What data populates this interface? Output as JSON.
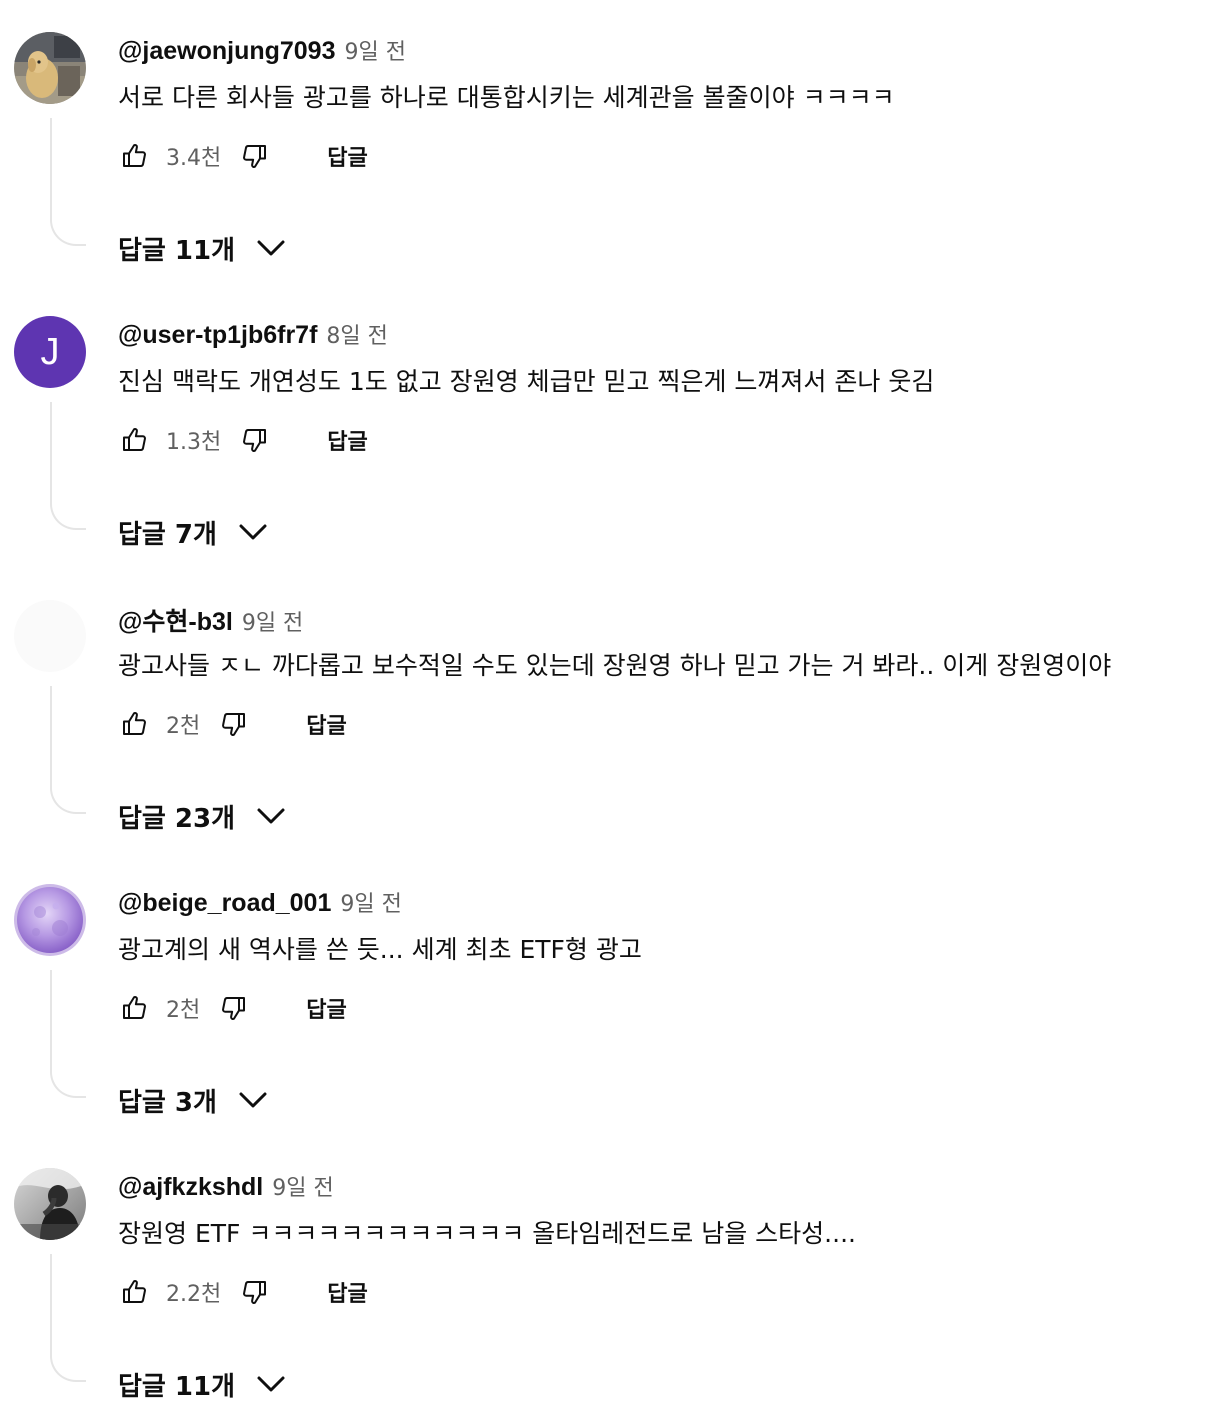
{
  "comments": [
    {
      "author": "@jaewonjung7093",
      "time": "9일 전",
      "text": "서로 다른 회사들 광고를 하나로 대통합시키는 세계관을 볼줄이야 ㅋㅋㅋㅋ",
      "likes": "3.4천",
      "reply_label": "답글",
      "replies_label": "답글 11개",
      "avatar": "photo-dog"
    },
    {
      "author": "@user-tp1jb6fr7f",
      "time": "8일 전",
      "text": "진심 맥락도 개연성도 1도 없고 장원영 체급만 믿고 찍은게 느껴져서 존나 웃김",
      "likes": "1.3천",
      "reply_label": "답글",
      "replies_label": "답글 7개",
      "avatar": "letter",
      "avatar_letter": "J",
      "avatar_color": "#5e35b1"
    },
    {
      "author": "@수현-b3l",
      "time": "9일 전",
      "text": "광고사들 ㅈㄴ 까다롭고 보수적일 수도 있는데 장원영 하나 믿고 가는 거 봐라.. 이게 장원영이야",
      "likes": "2천",
      "reply_label": "답글",
      "replies_label": "답글 23개",
      "avatar": "blank"
    },
    {
      "author": "@beige_road_001",
      "time": "9일 전",
      "text": "광고계의 새 역사를 쓴 듯... 세계 최초 ETF형 광고",
      "likes": "2천",
      "reply_label": "답글",
      "replies_label": "답글 3개",
      "avatar": "photo-purple-moon"
    },
    {
      "author": "@ajfkzkshdl",
      "time": "9일 전",
      "text": "장원영 ETF ㅋㅋㅋㅋㅋㅋㅋㅋㅋㅋㅋㅋ 올타임레전드로 남을 스타성....",
      "likes": "2.2천",
      "reply_label": "답글",
      "replies_label": "답글 11개",
      "avatar": "photo-bw-person"
    }
  ],
  "icons": {
    "like": "thumbs-up-icon",
    "dislike": "thumbs-down-icon",
    "expand": "chevron-down-icon"
  }
}
